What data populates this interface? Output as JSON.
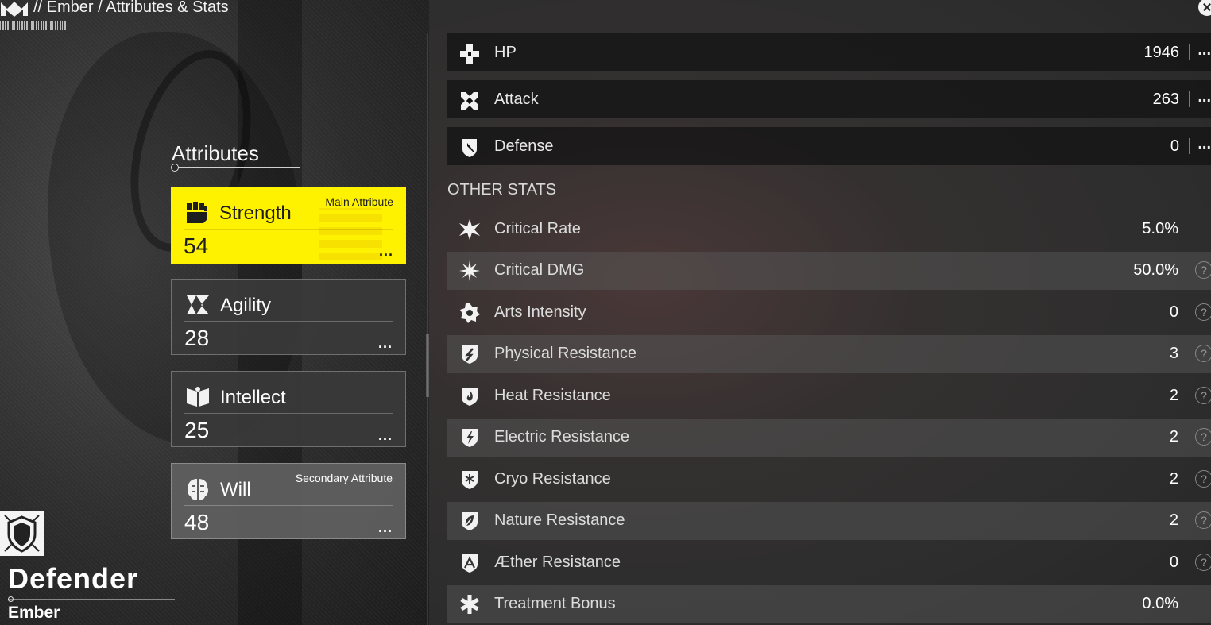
{
  "header": {
    "breadcrumb": "// Ember / Attributes & Stats"
  },
  "attributes": {
    "heading": "Attributes",
    "items": [
      {
        "name": "Strength",
        "value": "54",
        "tag": "Main Attribute",
        "icon": "fist-icon"
      },
      {
        "name": "Agility",
        "value": "28",
        "tag": "",
        "icon": "agility-arrow-icon"
      },
      {
        "name": "Intellect",
        "value": "25",
        "tag": "",
        "icon": "book-icon"
      },
      {
        "name": "Will",
        "value": "48",
        "tag": "Secondary Attribute",
        "icon": "brain-icon"
      }
    ],
    "more_label": "..."
  },
  "character": {
    "class_name": "Defender",
    "name": "Ember",
    "class_icon": "shield-icon"
  },
  "primary_stats": [
    {
      "label": "HP",
      "value": "1946",
      "icon": "cross-icon"
    },
    {
      "label": "Attack",
      "value": "263",
      "icon": "crossed-swords-icon"
    },
    {
      "label": "Defense",
      "value": "0",
      "icon": "shield-icon"
    }
  ],
  "other_stats": {
    "heading": "OTHER STATS",
    "items": [
      {
        "label": "Critical Rate",
        "value": "5.0%",
        "help": false,
        "icon": "burst-icon"
      },
      {
        "label": "Critical DMG",
        "value": "50.0%",
        "help": true,
        "icon": "star-burst-icon"
      },
      {
        "label": "Arts Intensity",
        "value": "0",
        "help": true,
        "icon": "gear-star-icon"
      },
      {
        "label": "Physical Resistance",
        "value": "3",
        "help": true,
        "icon": "physical-shield-icon"
      },
      {
        "label": "Heat Resistance",
        "value": "2",
        "help": true,
        "icon": "flame-shield-icon"
      },
      {
        "label": "Electric Resistance",
        "value": "2",
        "help": true,
        "icon": "lightning-shield-icon"
      },
      {
        "label": "Cryo Resistance",
        "value": "2",
        "help": true,
        "icon": "snowflake-shield-icon"
      },
      {
        "label": "Nature Resistance",
        "value": "2",
        "help": true,
        "icon": "leaf-shield-icon"
      },
      {
        "label": "Æther Resistance",
        "value": "0",
        "help": true,
        "icon": "aether-shield-icon"
      },
      {
        "label": "Treatment Bonus",
        "value": "0.0%",
        "help": false,
        "icon": "asterisk-icon"
      }
    ],
    "help_label": "?"
  },
  "colors": {
    "main_attribute": "#fff200",
    "panel_dark": "#121212"
  }
}
